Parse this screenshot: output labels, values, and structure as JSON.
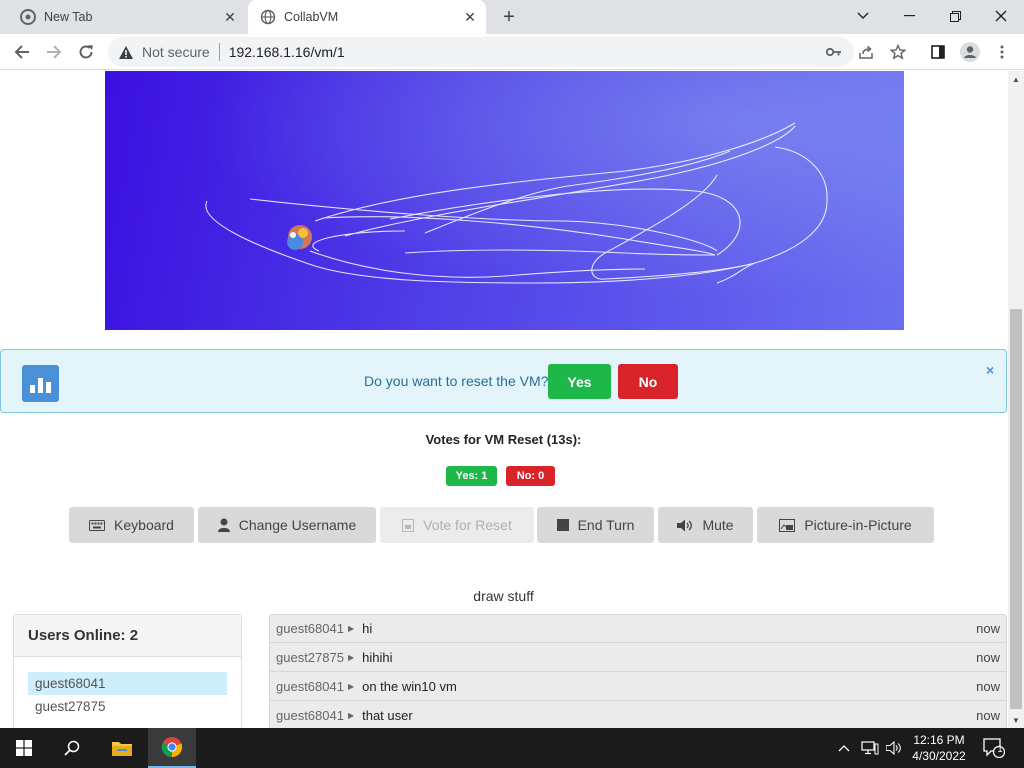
{
  "browser": {
    "tabs": [
      {
        "title": "New Tab",
        "active": false
      },
      {
        "title": "CollabVM",
        "active": true
      }
    ],
    "address": {
      "security_label": "Not secure",
      "url": "192.168.1.16/vm/1"
    }
  },
  "vote_alert": {
    "question": "Do you want to reset the VM?",
    "yes_label": "Yes",
    "no_label": "No",
    "close_glyph": "×"
  },
  "votes": {
    "title": "Votes for VM Reset (13s):",
    "yes_badge": "Yes: 1",
    "no_badge": "No: 0"
  },
  "controls": [
    {
      "label": "Keyboard",
      "icon": "keyboard-icon",
      "enabled": true
    },
    {
      "label": "Change Username",
      "icon": "user-icon",
      "enabled": true
    },
    {
      "label": "Vote for Reset",
      "icon": "reset-icon",
      "enabled": false
    },
    {
      "label": "End Turn",
      "icon": "stop-icon",
      "enabled": true
    },
    {
      "label": "Mute",
      "icon": "volume-icon",
      "enabled": true
    },
    {
      "label": "Picture-in-Picture",
      "icon": "pip-icon",
      "enabled": true
    }
  ],
  "motd": "draw stuff",
  "users": {
    "header": "Users Online: 2",
    "list": [
      "guest68041",
      "guest27875"
    ]
  },
  "chat": [
    {
      "sender": "guest68041",
      "message": "hi",
      "time": "now"
    },
    {
      "sender": "guest27875",
      "message": "hihihi",
      "time": "now"
    },
    {
      "sender": "guest68041",
      "message": "on the win10 vm",
      "time": "now"
    },
    {
      "sender": "guest68041",
      "message": "that user",
      "time": "now"
    }
  ],
  "taskbar": {
    "time": "12:16 PM",
    "date": "4/30/2022",
    "notification_count": "1"
  },
  "colors": {
    "vote_yes": "#1eb74a",
    "vote_no": "#d9232b",
    "alert_bg": "#e3f4fb",
    "alert_text": "#2a6f97"
  }
}
